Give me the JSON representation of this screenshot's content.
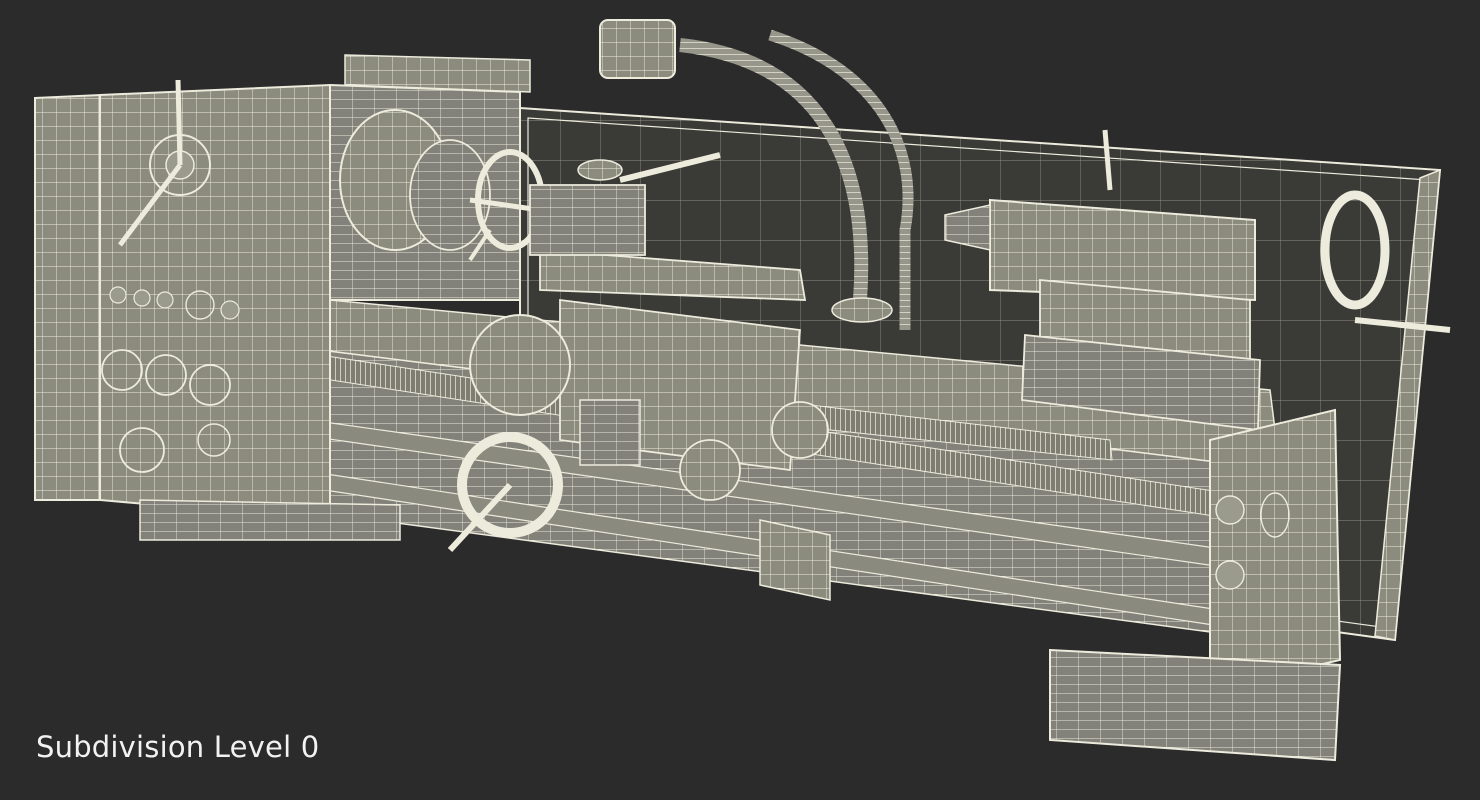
{
  "caption": "Subdivision Level 0",
  "colors": {
    "background": "#2b2b2b",
    "surface": "#8d8d80",
    "surface_dark": "#3b3b37",
    "wire": "#ecebdc"
  }
}
